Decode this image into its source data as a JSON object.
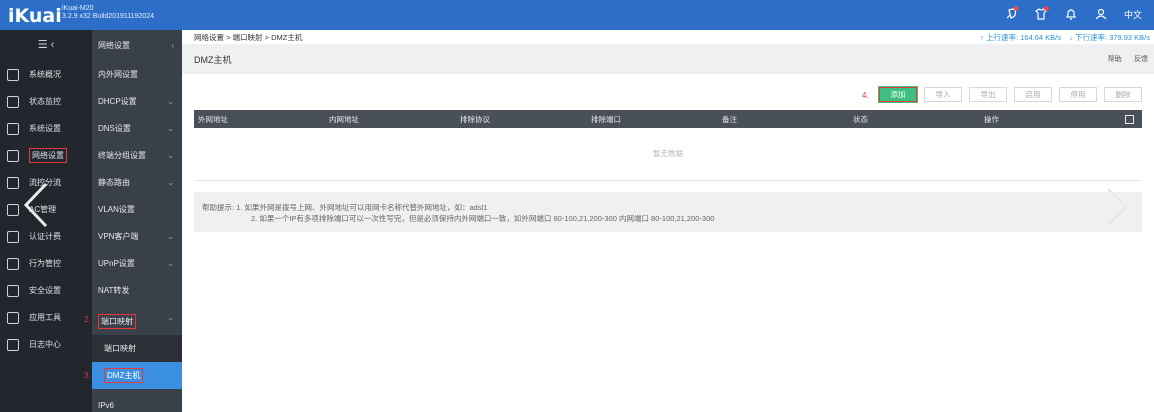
{
  "header": {
    "logo": "iKuai",
    "model": "iKuai-M20",
    "build": "3.2.9 x32 Build201911192024",
    "lang": "中文",
    "icons": [
      "rocket-icon",
      "shirt-icon",
      "bell-icon",
      "user-icon"
    ]
  },
  "sidebar": {
    "collapse_label": "☰ ‹",
    "items": [
      {
        "label": "系统概况",
        "icon": "dashboard-icon"
      },
      {
        "label": "状态监控",
        "icon": "monitor-icon"
      },
      {
        "label": "系统设置",
        "icon": "gear-icon"
      },
      {
        "label": "网络设置",
        "icon": "network-icon"
      },
      {
        "label": "流控分流",
        "icon": "flow-icon"
      },
      {
        "label": "AC管理",
        "icon": "ac-icon"
      },
      {
        "label": "认证计费",
        "icon": "auth-icon"
      },
      {
        "label": "行为管控",
        "icon": "behavior-icon"
      },
      {
        "label": "安全设置",
        "icon": "security-icon"
      },
      {
        "label": "应用工具",
        "icon": "tools-icon"
      },
      {
        "label": "日志中心",
        "icon": "log-icon"
      }
    ]
  },
  "subnav": {
    "title": "网络设置",
    "items": [
      {
        "label": "内外网设置",
        "chevron": ""
      },
      {
        "label": "DHCP设置",
        "chevron": "⌄"
      },
      {
        "label": "DNS设置",
        "chevron": "⌄"
      },
      {
        "label": "终端分组设置",
        "chevron": "⌄"
      },
      {
        "label": "静态路由",
        "chevron": "⌄"
      },
      {
        "label": "VLAN设置",
        "chevron": ""
      },
      {
        "label": "VPN客户端",
        "chevron": "⌄"
      },
      {
        "label": "UPnP设置",
        "chevron": "⌄"
      },
      {
        "label": "NAT转发",
        "chevron": ""
      },
      {
        "label": "端口映射",
        "chevron": "⌃"
      },
      {
        "label": "端口映射",
        "chevron": ""
      },
      {
        "label": "DMZ主机",
        "chevron": ""
      },
      {
        "label": "IPv6",
        "chevron": ""
      }
    ],
    "steps": {
      "s2": "2.",
      "s3": "3."
    }
  },
  "main": {
    "breadcrumb": "网络设置 > 端口映射 > DMZ主机",
    "upload": "↑ 上行速率: 164.64 KB/s",
    "download": "↓ 下行速率: 379.93 KB/s",
    "title": "DMZ主机",
    "help_link": "帮助",
    "feedback_link": "反馈",
    "step4": "4.",
    "buttons": {
      "add": "添加",
      "import": "导入",
      "export": "导出",
      "enable": "启用",
      "disable": "停用",
      "delete": "删除"
    },
    "columns": [
      "外网地址",
      "内网地址",
      "排除协议",
      "排除端口",
      "备注",
      "状态",
      "操作"
    ],
    "empty": "暂无数据",
    "help_line1": "帮助提示: 1. 如果外网是拨号上网、外网地址可以用网卡名称代替外网地址，如：adsl1",
    "help_line2": "2. 如果一个IP有多项排除端口可以一次性写完，但是必须保持内外网端口一致，如外网端口 80-100,21,200-300 内网端口 80-100,21,200-300"
  }
}
